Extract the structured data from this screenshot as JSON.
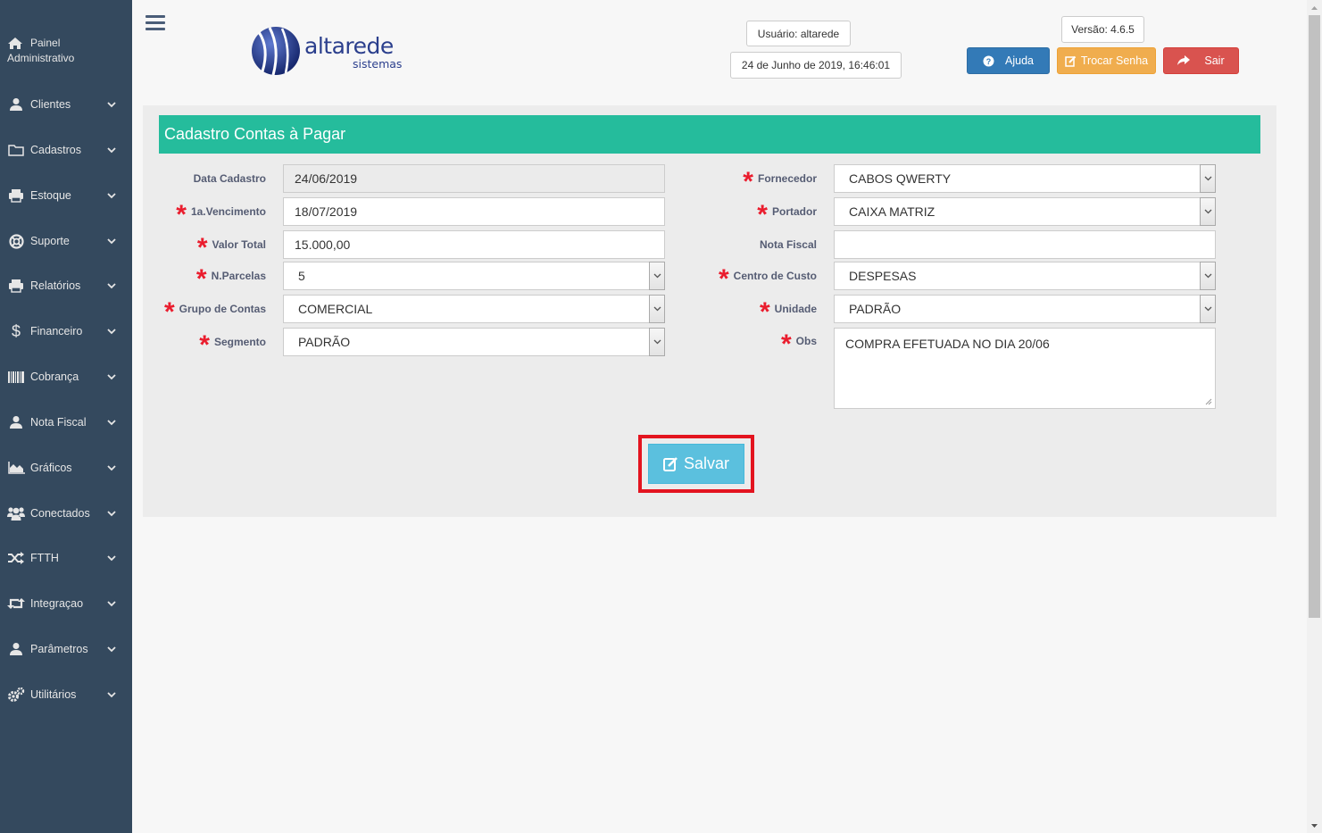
{
  "sidebar": {
    "top": {
      "line1": "Painel",
      "line2": "Administrativo"
    },
    "items": [
      {
        "label": "Clientes",
        "icon": "user-icon"
      },
      {
        "label": "Cadastros",
        "icon": "folder-icon"
      },
      {
        "label": "Estoque",
        "icon": "printer-icon"
      },
      {
        "label": "Suporte",
        "icon": "lifebuoy-icon"
      },
      {
        "label": "Relatórios",
        "icon": "printer-icon"
      },
      {
        "label": "Financeiro",
        "icon": "dollar-icon"
      },
      {
        "label": "Cobrança",
        "icon": "barcode-icon"
      },
      {
        "label": "Nota Fiscal",
        "icon": "user-icon"
      },
      {
        "label": "Gráficos",
        "icon": "area-chart-icon"
      },
      {
        "label": "Conectados",
        "icon": "users-icon"
      },
      {
        "label": "FTTH",
        "icon": "random-icon"
      },
      {
        "label": "Integraçao",
        "icon": "retweet-icon"
      },
      {
        "label": "Parâmetros",
        "icon": "user-icon"
      },
      {
        "label": "Utilitários",
        "icon": "gears-icon"
      }
    ]
  },
  "header": {
    "brand": "altarede",
    "brand_sub": "sistemas",
    "user": "Usuário: altarede",
    "datetime": "24 de Junho de 2019, 16:46:01",
    "version": "Versão: 4.6.5",
    "help": "Ajuda",
    "change_password": "Trocar Senha",
    "logout": "Sair"
  },
  "colors": {
    "sidebar": "#34495e",
    "panel_header": "#25bc9c",
    "help": "#337ab7",
    "change_password": "#f0ad4e",
    "logout": "#d9534f",
    "save": "#5bc0de",
    "highlight": "#e3141f",
    "required": "#ea1c2d"
  },
  "form": {
    "title": "Cadastro Contas à Pagar",
    "data_cadastro": {
      "label": "Data Cadastro",
      "value": "24/06/2019"
    },
    "vencimento": {
      "label": "1a.Vencimento",
      "value": "18/07/2019"
    },
    "valor_total": {
      "label": "Valor Total",
      "value": "15.000,00"
    },
    "parcelas": {
      "label": "N.Parcelas",
      "value": "5"
    },
    "grupo_contas": {
      "label": "Grupo de Contas",
      "value": "COMERCIAL"
    },
    "segmento": {
      "label": "Segmento",
      "value": "PADRÃO"
    },
    "fornecedor": {
      "label": "Fornecedor",
      "value": "CABOS QWERTY"
    },
    "portador": {
      "label": "Portador",
      "value": "CAIXA MATRIZ"
    },
    "nota_fiscal": {
      "label": "Nota Fiscal",
      "value": ""
    },
    "centro_custo": {
      "label": "Centro de Custo",
      "value": "DESPESAS"
    },
    "unidade": {
      "label": "Unidade",
      "value": "PADRÃO"
    },
    "obs": {
      "label": "Obs",
      "value": "COMPRA EFETUADA NO DIA 20/06"
    },
    "save": "Salvar"
  }
}
